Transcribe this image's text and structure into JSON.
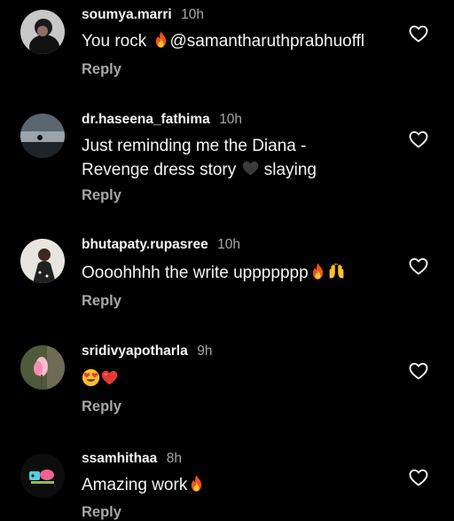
{
  "colors": {
    "background": "#000000",
    "text": "#f5f5f5",
    "secondary_text": "#a8a8a8"
  },
  "comments": [
    {
      "username": "soumya.marri",
      "time": "10h",
      "text": "You rock ",
      "text_after": "@samantharuthprabhuoffl",
      "emojis": [
        "fire-emoji"
      ],
      "reply_label": "Reply",
      "like_icon": "heart-outline-icon"
    },
    {
      "username": "dr.haseena_fathima",
      "time": "10h",
      "text": "Just reminding me the Diana - Revenge dress story ",
      "text_after": " slaying",
      "emojis": [
        "black-heart-emoji"
      ],
      "reply_label": "Reply",
      "like_icon": "heart-outline-icon"
    },
    {
      "username": "bhutapaty.rupasree",
      "time": "10h",
      "text": "Oooohhhh the write uppppppp",
      "emojis": [
        "fire-emoji",
        "raising-hands-emoji"
      ],
      "reply_label": "Reply",
      "like_icon": "heart-outline-icon"
    },
    {
      "username": "sridivyapotharla",
      "time": "9h",
      "text": "",
      "emojis": [
        "heart-eyes-emoji",
        "red-heart-emoji"
      ],
      "reply_label": "Reply",
      "like_icon": "heart-outline-icon"
    },
    {
      "username": "ssamhithaa",
      "time": "8h",
      "text": "Amazing work",
      "emojis": [
        "fire-emoji"
      ],
      "reply_label": "Reply",
      "like_icon": "heart-outline-icon"
    }
  ]
}
